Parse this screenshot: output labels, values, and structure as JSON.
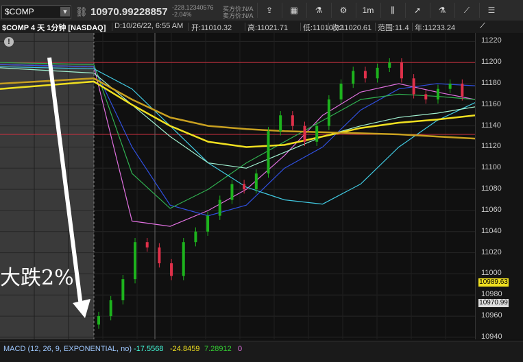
{
  "toolbar": {
    "symbol": "$COMP",
    "price": "10970.99228857",
    "change_abs": "-228.12340576",
    "change_pct": "-2.04%",
    "bid": "买方价:N/A",
    "ask": "卖方价:N/A",
    "interval": "1m",
    "icons": [
      "share-icon",
      "calendar-icon",
      "flask-icon",
      "settings-icon",
      "interval-button",
      "candle-icon",
      "cursor-icon",
      "beaker-icon",
      "drawing-icon",
      "more-icon"
    ]
  },
  "info": {
    "title": "$COMP 4 天 1分钟 [NASDAQ]",
    "datetime": "D:10/26/22, 6:55 AM",
    "open": "开:11010.32",
    "high": "高:11021.71",
    "low": "低:11010.32",
    "close": "收:11020.61",
    "range": "范围:11.4",
    "year": "年:11233.24"
  },
  "annotation": "大跌2%",
  "price_labels": {
    "yellow": "10989.63",
    "last": "10970.99"
  },
  "macd": {
    "label": "MACD (12, 26, 9, EXPONENTIAL, no)",
    "v1": "-17.5568",
    "v2": "-24.8459",
    "v3": "7.28912",
    "v4": "0"
  },
  "colors": {
    "up": "#1db31d",
    "down": "#e0304a",
    "yellow": "#f0e020",
    "pink": "#e070e0",
    "cyan": "#40c8e0",
    "green": "#30b050",
    "blue": "#3050e0",
    "gold": "#c8a020",
    "mint": "#a0f0d0"
  },
  "chart_data": {
    "type": "line",
    "y_axis_ticks": [
      11220,
      11200,
      11180,
      11160,
      11140,
      11120,
      11100,
      11080,
      11060,
      11040,
      11020,
      11000,
      10980,
      10960,
      10940
    ],
    "ylim": [
      10938,
      11228
    ],
    "horizontal_lines": [
      11200,
      11132
    ],
    "series": [
      {
        "color": "#e070e0",
        "values": [
          11198,
          11196,
          11050,
          11045,
          11060,
          11080,
          11112,
          11150,
          11172,
          11180,
          11172,
          11165
        ]
      },
      {
        "color": "#3050e0",
        "values": [
          11198,
          11196,
          11120,
          11065,
          11055,
          11065,
          11100,
          11120,
          11155,
          11175,
          11180,
          11178
        ]
      },
      {
        "color": "#30b050",
        "values": [
          11200,
          11198,
          11095,
          11062,
          11080,
          11105,
          11125,
          11145,
          11165,
          11170,
          11168,
          11165
        ]
      },
      {
        "color": "#40c8e0",
        "values": [
          11196,
          11194,
          11175,
          11140,
          11105,
          11082,
          11070,
          11066,
          11085,
          11120,
          11145,
          11162
        ]
      },
      {
        "color": "#a0f0d0",
        "values": [
          11195,
          11190,
          11160,
          11130,
          11105,
          11100,
          11115,
          11130,
          11140,
          11148,
          11152,
          11158
        ]
      },
      {
        "color": "#f0e020",
        "values": [
          11175,
          11182,
          11160,
          11140,
          11125,
          11120,
          11122,
          11130,
          11138,
          11143,
          11146,
          11150
        ]
      },
      {
        "color": "#c8a020",
        "values": [
          11180,
          11185,
          11165,
          11148,
          11140,
          11137,
          11135,
          11134,
          11133,
          11132,
          11130,
          11128
        ]
      }
    ],
    "candles_close": [
      10960,
      10975,
      10995,
      11030,
      11025,
      11010,
      10998,
      11030,
      11040,
      11055,
      11070,
      11085,
      11080,
      11095,
      11135,
      11150,
      11140,
      11125,
      11140,
      11165,
      11180,
      11192,
      11185,
      11195,
      11200,
      11185,
      11170,
      11165,
      11175,
      11180,
      11168
    ]
  }
}
